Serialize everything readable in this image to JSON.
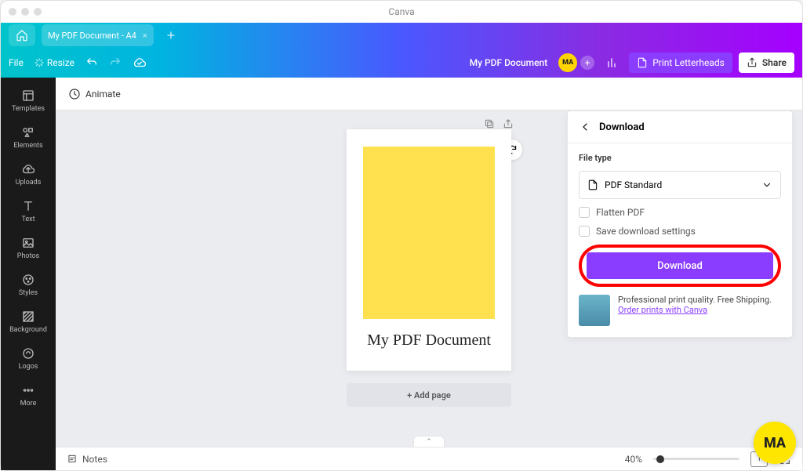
{
  "app": {
    "title": "Canva"
  },
  "tabs": {
    "home_icon": "home",
    "document": "My PDF Document - A4"
  },
  "toolbar": {
    "file": "File",
    "resize": "Resize",
    "doc_title": "My PDF Document",
    "avatar": "MA",
    "print": "Print Letterheads",
    "share": "Share"
  },
  "sidebar": {
    "items": [
      {
        "label": "Templates"
      },
      {
        "label": "Elements"
      },
      {
        "label": "Uploads"
      },
      {
        "label": "Text"
      },
      {
        "label": "Photos"
      },
      {
        "label": "Styles"
      },
      {
        "label": "Background"
      },
      {
        "label": "Logos"
      },
      {
        "label": "More"
      }
    ]
  },
  "subtoolbar": {
    "animate": "Animate"
  },
  "canvas": {
    "doc_text": "My PDF Document",
    "add_page": "+ Add page"
  },
  "panel": {
    "title": "Download",
    "file_type_label": "File type",
    "file_type_value": "PDF Standard",
    "flatten": "Flatten PDF",
    "save_settings": "Save download settings",
    "download_btn": "Download",
    "promo_text": "Professional print quality. Free Shipping.",
    "promo_link": "Order prints with Canva"
  },
  "footer": {
    "notes": "Notes",
    "zoom": "40%",
    "page": "1"
  },
  "badge": "MA"
}
